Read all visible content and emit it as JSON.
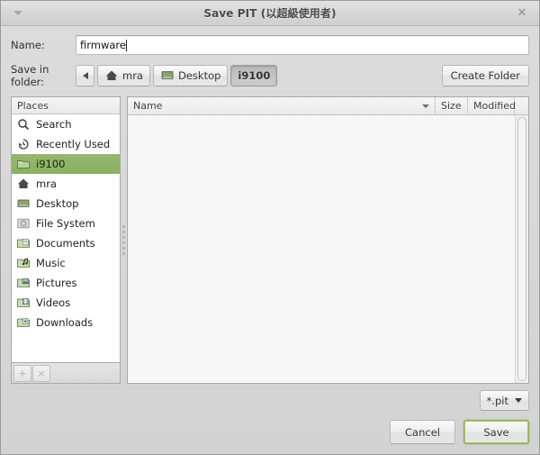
{
  "window": {
    "title": "Save PIT (以超級使用者)",
    "menu_icon": "menu-triangle-icon",
    "close_icon": "close-icon"
  },
  "form": {
    "name_label": "Name:",
    "name_value": "firmware",
    "name_placeholder": "",
    "folder_label": "Save in folder:",
    "create_folder_label": "Create Folder"
  },
  "breadcrumb": {
    "back_icon": "arrow-left-icon",
    "items": [
      {
        "label": "mra",
        "icon": "home-icon",
        "active": false
      },
      {
        "label": "Desktop",
        "icon": "desktop-icon",
        "active": false
      },
      {
        "label": "i9100",
        "icon": "",
        "active": true
      }
    ]
  },
  "places": {
    "header": "Places",
    "items": [
      {
        "label": "Search",
        "icon": "search-icon",
        "selected": false
      },
      {
        "label": "Recently Used",
        "icon": "recent-icon",
        "selected": false
      },
      {
        "label": "i9100",
        "icon": "folder-icon",
        "selected": true
      },
      {
        "label": "mra",
        "icon": "home-icon",
        "selected": false
      },
      {
        "label": "Desktop",
        "icon": "desktop-icon",
        "selected": false
      },
      {
        "label": "File System",
        "icon": "drive-icon",
        "selected": false
      },
      {
        "label": "Documents",
        "icon": "folder-documents-icon",
        "selected": false
      },
      {
        "label": "Music",
        "icon": "folder-music-icon",
        "selected": false
      },
      {
        "label": "Pictures",
        "icon": "folder-pictures-icon",
        "selected": false
      },
      {
        "label": "Videos",
        "icon": "folder-videos-icon",
        "selected": false
      },
      {
        "label": "Downloads",
        "icon": "folder-downloads-icon",
        "selected": false
      }
    ],
    "add_label": "+",
    "remove_label": "×"
  },
  "file_list": {
    "columns": [
      {
        "label": "Name",
        "sorted": true,
        "sort_icon": "sort-descending-icon"
      },
      {
        "label": "Size",
        "sorted": false
      },
      {
        "label": "Modified",
        "sorted": false
      }
    ],
    "rows": []
  },
  "filter": {
    "selected": "*.pit",
    "chevron_icon": "chevron-down-icon"
  },
  "actions": {
    "cancel_label": "Cancel",
    "save_label": "Save"
  },
  "colors": {
    "selection_green": "#8bb062",
    "focus_green": "#8db04f",
    "window_bg": "#d6d6d6",
    "list_bg": "#f7f7f7"
  }
}
